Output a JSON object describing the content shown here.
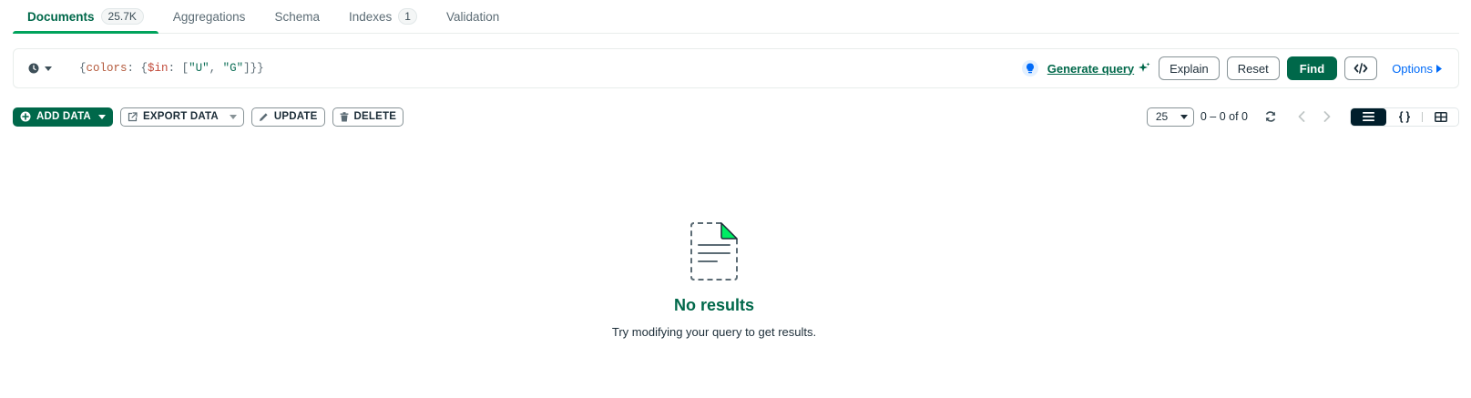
{
  "tabs": [
    {
      "label": "Documents",
      "count": "25.7K"
    },
    {
      "label": "Aggregations"
    },
    {
      "label": "Schema"
    },
    {
      "label": "Indexes",
      "count": "1"
    },
    {
      "label": "Validation"
    }
  ],
  "query": {
    "p1": "{",
    "key": "colors",
    "p2": ": {",
    "op": "$in",
    "p3": ": [",
    "v1": "\"U\"",
    "p4": ", ",
    "v2": "\"G\"",
    "p5": "]}}"
  },
  "querybar_actions": {
    "generate_query": "Generate query",
    "explain": "Explain",
    "reset": "Reset",
    "find": "Find",
    "options": "Options"
  },
  "toolbar": {
    "add_data": "ADD DATA",
    "export_data": "EXPORT DATA",
    "update": "UPDATE",
    "delete": "DELETE"
  },
  "pagination": {
    "page_size": "25",
    "range": "0 – 0 of 0"
  },
  "empty_state": {
    "title": "No results",
    "subtitle": "Try modifying your query to get results."
  },
  "colors": {
    "primary": "#00684a",
    "accent_green": "#00ed64",
    "link_blue": "#016bf8",
    "dark": "#001e2b"
  }
}
